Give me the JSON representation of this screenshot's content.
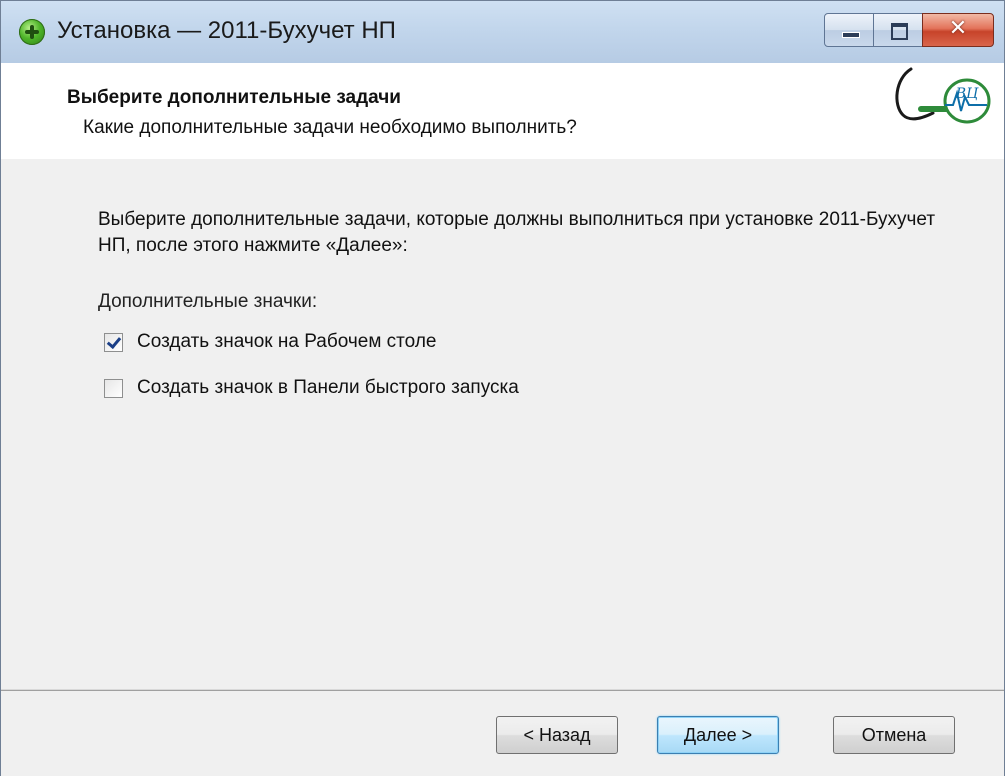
{
  "window": {
    "title": "Установка — 2011-Бухучет НП",
    "minimize_glyph": "",
    "maximize_glyph": "",
    "close_glyph": "✕"
  },
  "header": {
    "title": "Выберите дополнительные задачи",
    "subtitle": "Какие дополнительные задачи необходимо выполнить?",
    "logo_text": "ВЦ",
    "logo_colors": {
      "primary": "#2e8b3a",
      "accent": "#0d6ea8"
    }
  },
  "body": {
    "description": "Выберите дополнительные задачи, которые должны выполниться при установке 2011-Бухучет НП, после этого нажмите «Далее»:",
    "section_label": "Дополнительные значки:",
    "tasks": [
      {
        "label": "Создать значок на Рабочем столе",
        "checked": true
      },
      {
        "label": "Создать значок в Панели быстрого запуска",
        "checked": false
      }
    ]
  },
  "footer": {
    "back_label": "< Назад",
    "next_label": "Далее >",
    "cancel_label": "Отмена"
  },
  "colors": {
    "titlebar": "#c2d6ec",
    "close_button": "#c7432a",
    "default_button_border": "#3c7fb1"
  }
}
